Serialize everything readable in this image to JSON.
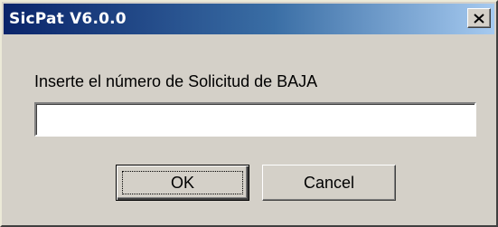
{
  "window": {
    "title": "SicPat V6.0.0",
    "close_icon": "close-icon"
  },
  "dialog": {
    "prompt": "Inserte el número de Solicitud de BAJA",
    "input_value": "",
    "ok_label": "OK",
    "cancel_label": "Cancel"
  },
  "colors": {
    "titlebar_start": "#0a246a",
    "titlebar_end": "#a6caf0",
    "dialog_background": "#d4d0c8",
    "input_background": "#ffffff"
  }
}
